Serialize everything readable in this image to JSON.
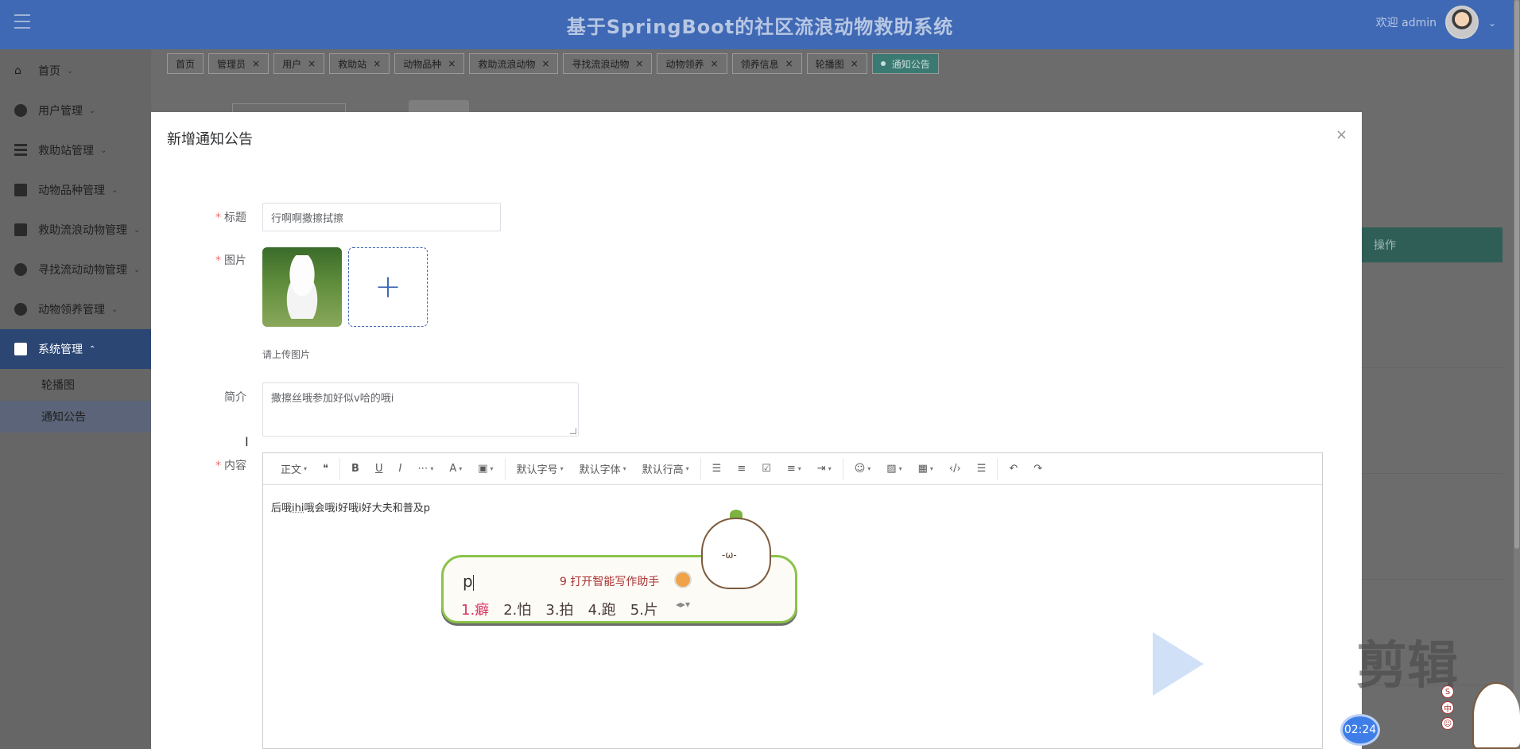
{
  "header": {
    "title": "基于SpringBoot的社区流浪动物救助系统",
    "welcome": "欢迎 admin"
  },
  "sidebar": {
    "items": [
      {
        "label": "首页",
        "icon": "home-icon"
      },
      {
        "label": "用户管理",
        "icon": "pie-icon"
      },
      {
        "label": "救助站管理",
        "icon": "list-icon"
      },
      {
        "label": "动物品种管理",
        "icon": "table-icon"
      },
      {
        "label": "救助流浪动物管理",
        "icon": "briefcase-icon"
      },
      {
        "label": "寻找流动动物管理",
        "icon": "pie-icon"
      },
      {
        "label": "动物领养管理",
        "icon": "more-icon"
      },
      {
        "label": "系统管理",
        "icon": "car-icon"
      }
    ],
    "subitems": [
      "轮播图",
      "通知公告"
    ]
  },
  "tabs": [
    "首页",
    "管理员",
    "用户",
    "救助站",
    "动物品种",
    "救助流浪动物",
    "寻找流浪动物",
    "动物领养",
    "领养信息",
    "轮播图",
    "通知公告"
  ],
  "background": {
    "column_header": "操作"
  },
  "modal": {
    "title": "新增通知公告",
    "close": "×",
    "form": {
      "title_label": "标题",
      "title_value": "行啊啊撒擦拭擦",
      "image_label": "图片",
      "upload_tip": "请上传图片",
      "intro_label": "简介",
      "intro_value": "撒擦丝哦参加好似v哈的哦i",
      "content_label": "内容",
      "content_value_a": "后哦",
      "content_value_u": "ihi",
      "content_value_b": "哦会哦i好哦i好大夫和普及p"
    },
    "toolbar": {
      "paragraph": "正文",
      "font_size": "默认字号",
      "font_family": "默认字体",
      "line_height": "默认行高"
    }
  },
  "ime": {
    "pinyin": "p",
    "assist": "9 打开智能写作助手",
    "candidates": [
      "1.癖",
      "2.怕",
      "3.拍",
      "4.跑",
      "5.片"
    ],
    "face": "-ω-"
  },
  "overlay": {
    "watermark": "剪辑",
    "timer": "02:24",
    "side_buttons": [
      "S",
      "中",
      "☺"
    ]
  }
}
